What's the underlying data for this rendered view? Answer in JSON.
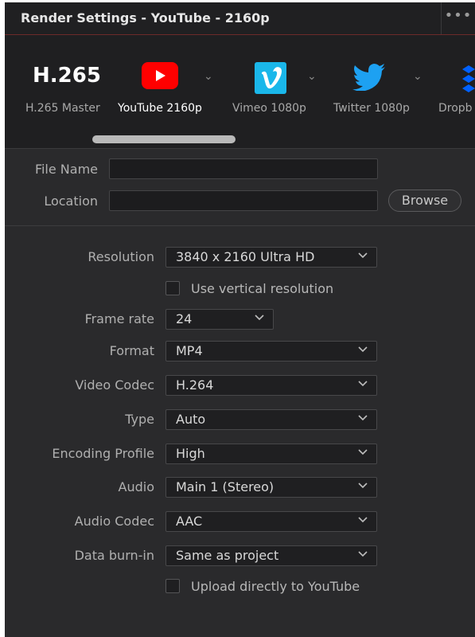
{
  "window": {
    "title": "Render Settings - YouTube - 2160p",
    "more_label": "•••"
  },
  "presets": [
    {
      "icon_text": "H.265",
      "label": "H.265 Master"
    },
    {
      "label": "YouTube 2160p"
    },
    {
      "label": "Vimeo 1080p"
    },
    {
      "label": "Twitter 1080p"
    },
    {
      "label": "Dropb"
    }
  ],
  "file": {
    "file_name_label": "File Name",
    "file_name_value": "",
    "location_label": "Location",
    "location_value": "",
    "browse_label": "Browse"
  },
  "settings": {
    "resolution_label": "Resolution",
    "resolution_value": "3840 x 2160 Ultra HD",
    "vertical_label": "Use vertical resolution",
    "framerate_label": "Frame rate",
    "framerate_value": "24",
    "format_label": "Format",
    "format_value": "MP4",
    "video_codec_label": "Video Codec",
    "video_codec_value": "H.264",
    "type_label": "Type",
    "type_value": "Auto",
    "encoding_label": "Encoding Profile",
    "encoding_value": "High",
    "audio_label": "Audio",
    "audio_value": "Main 1 (Stereo)",
    "audio_codec_label": "Audio Codec",
    "audio_codec_value": "AAC",
    "burnin_label": "Data burn-in",
    "burnin_value": "Same as project",
    "upload_label": "Upload directly to YouTube"
  },
  "colors": {
    "youtube": "#ff0000",
    "vimeo": "#1ab7ea",
    "twitter": "#1da1f2",
    "dropbox": "#0061ff"
  }
}
